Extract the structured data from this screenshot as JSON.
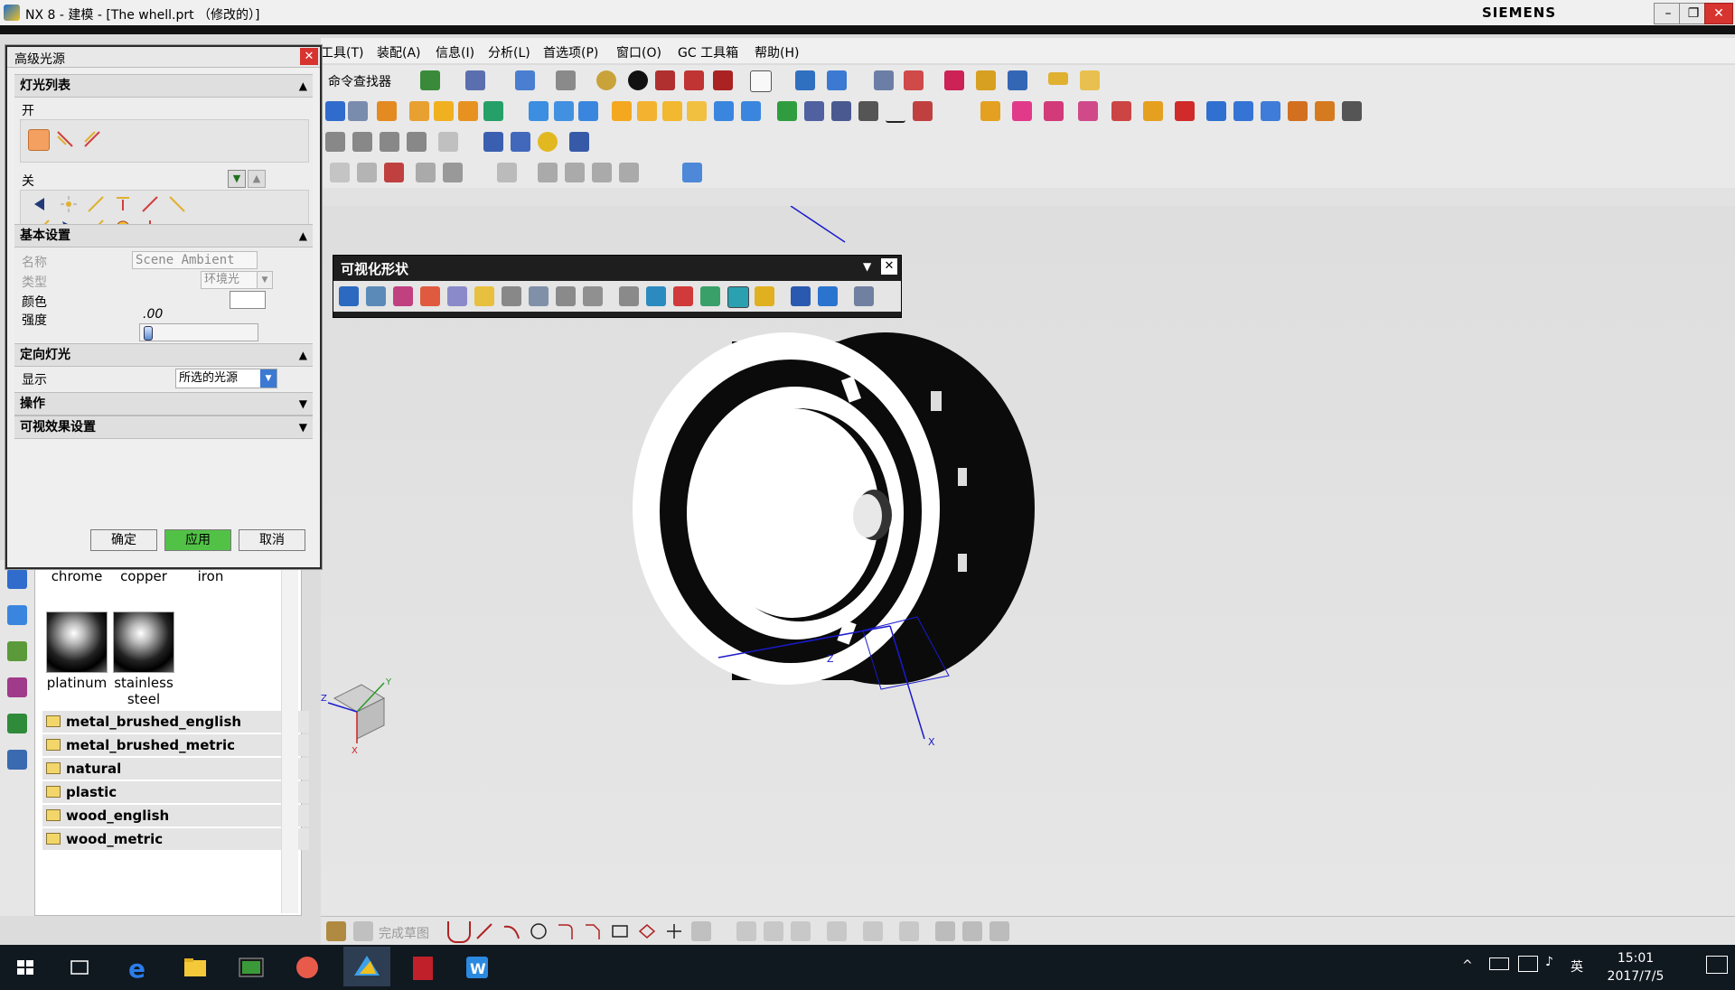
{
  "window": {
    "title": "NX 8 - 建模 - [The whell.prt （修改的）]",
    "brand": "SIEMENS",
    "controls": [
      "–",
      "❐",
      "✕"
    ]
  },
  "menu": [
    "工具(T)",
    "装配(A)",
    "信息(I)",
    "分析(L)",
    "首选项(P)",
    "窗口(O)",
    "GC 工具箱",
    "帮助(H)"
  ],
  "toolbar": {
    "command_finder": "命令查找器"
  },
  "dialog": {
    "title": "高级光源",
    "sections": {
      "light_list": "灯光列表",
      "on": "开",
      "off": "关",
      "basic": "基本设置",
      "directional": "定向灯光",
      "operation": "操作",
      "visual_effects": "可视效果设置"
    },
    "fields": {
      "name_label": "名称",
      "name_value": "Scene Ambient",
      "type_label": "类型",
      "type_value": "环境光",
      "color_label": "颜色",
      "intensity_label": "强度",
      "intensity_value": ".00",
      "display_label": "显示",
      "display_value": "所选的光源"
    },
    "buttons": {
      "ok": "确定",
      "apply": "应用",
      "cancel": "取消"
    },
    "intensity_fraction": 0.0
  },
  "visualize_toolbar": {
    "title": "可视化形状"
  },
  "materials": {
    "row1": [
      "chrome",
      "copper",
      "iron"
    ],
    "spheres": [
      {
        "name": "platinum"
      },
      {
        "name": "stainless steel"
      }
    ],
    "folders": [
      "metal_brushed_english",
      "metal_brushed_metric",
      "natural",
      "plastic",
      "wood_english",
      "wood_metric"
    ]
  },
  "sketch_bar": {
    "finish_sketch": "完成草图"
  },
  "axes": {
    "x": "X",
    "y": "Y",
    "z": "Z"
  },
  "taskbar": {
    "ime": "英",
    "time": "15:01",
    "date": "2017/7/5"
  },
  "colors": {
    "apply_green": "#52c247",
    "close_red": "#d7332f",
    "taskbar": "#101820",
    "wheel_dark": "#0b0b0b"
  }
}
